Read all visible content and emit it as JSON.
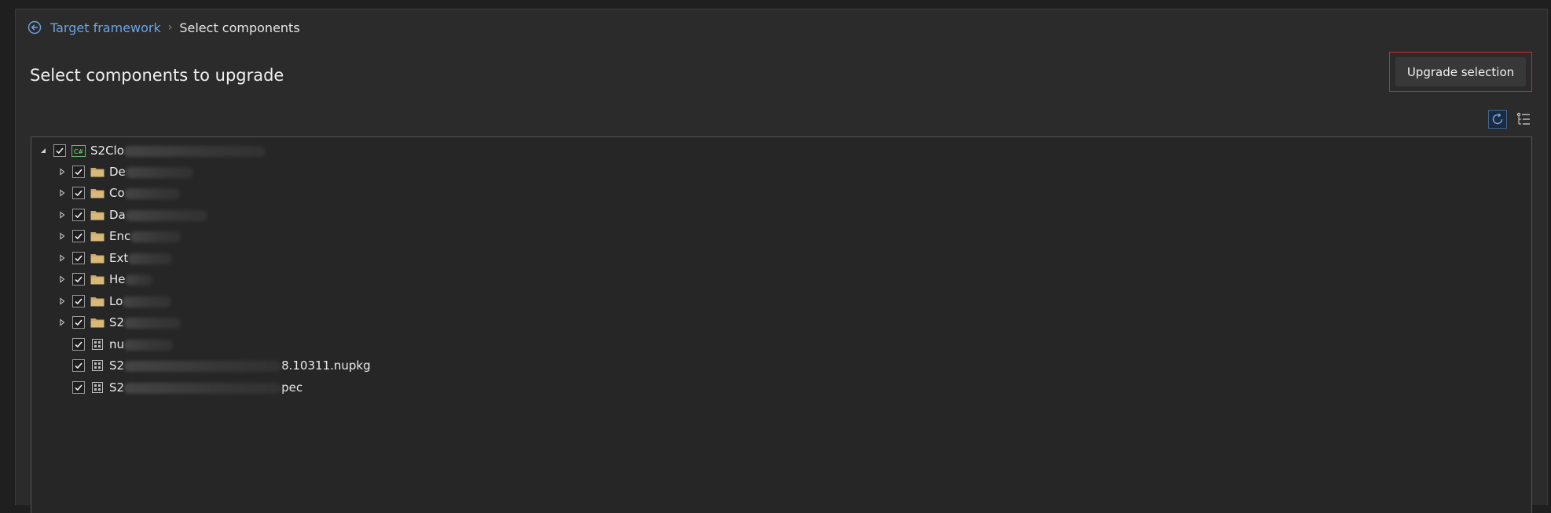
{
  "breadcrumb": {
    "parent": "Target framework",
    "separator": "›",
    "current": "Select components"
  },
  "page": {
    "title": "Select components to upgrade"
  },
  "toolbar": {
    "upgrade_label": "Upgrade selection"
  },
  "tree": {
    "root": {
      "label_visible": "S2Clo",
      "icon": "csharp-project-icon",
      "checked": true,
      "expanded": true
    },
    "folders": [
      {
        "label_visible": "De",
        "checked": true
      },
      {
        "label_visible": "Co",
        "checked": true
      },
      {
        "label_visible": "Da",
        "checked": true
      },
      {
        "label_visible": "Enc",
        "checked": true
      },
      {
        "label_visible": "Ext",
        "checked": true
      },
      {
        "label_visible": "He",
        "checked": true
      },
      {
        "label_visible": "Lo",
        "checked": true
      },
      {
        "label_visible": "S2",
        "checked": true
      }
    ],
    "files": [
      {
        "label_start": "nu",
        "label_end": "",
        "checked": true
      },
      {
        "label_start": "S2",
        "label_end": "8.10311.nupkg",
        "checked": true
      },
      {
        "label_start": "S2",
        "label_end": "pec",
        "checked": true
      }
    ]
  },
  "colors": {
    "accent": "#6ba4e6",
    "highlight_border": "#d22a2a",
    "folder": "#c9a86a",
    "csharp_icon": "#6fb36f"
  }
}
